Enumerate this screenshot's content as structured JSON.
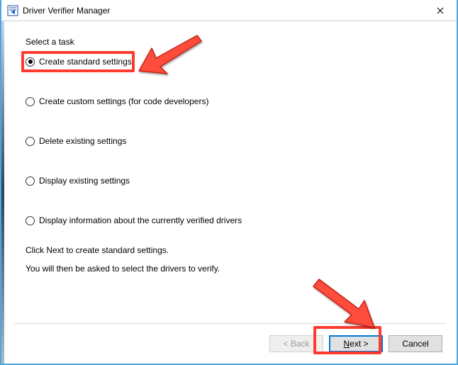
{
  "titlebar": {
    "title": "Driver Verifier Manager"
  },
  "content": {
    "task_label": "Select a task",
    "options": [
      {
        "label": "Create standard settings",
        "selected": true
      },
      {
        "label": "Create custom settings (for code developers)",
        "selected": false
      },
      {
        "label": "Delete existing settings",
        "selected": false
      },
      {
        "label": "Display existing settings",
        "selected": false
      },
      {
        "label": "Display information about the currently verified drivers",
        "selected": false
      }
    ],
    "hint_line1": "Click Next to create standard settings.",
    "hint_line2": "You will then be asked to select the drivers to verify."
  },
  "buttons": {
    "back": "< Back",
    "next_prefix": "N",
    "next_rest": "ext >",
    "cancel": "Cancel"
  },
  "annotations": {
    "highlight_option": 0,
    "highlight_next": true,
    "arrow_color": "#ff3b30"
  }
}
